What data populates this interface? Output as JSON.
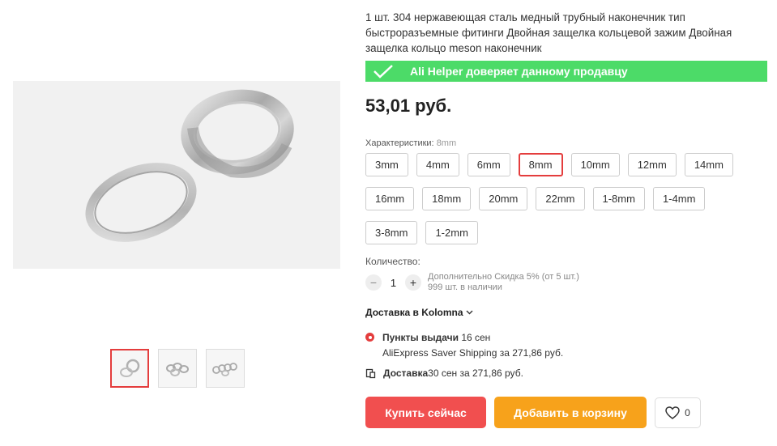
{
  "product": {
    "title": "1 шт. 304 нержавеющая сталь медный трубный наконечник тип быстроразъемные фитинги Двойная защелка кольцевой зажим Двойная защелка кольцо meson наконечник",
    "trust_badge": "Ali Helper доверяет данному продавцу",
    "price": "53,01 руб."
  },
  "gallery": {
    "thumbnails": [
      "thumb-1",
      "thumb-2",
      "thumb-3"
    ]
  },
  "specs": {
    "label": "Характеристики: ",
    "selected": "8mm",
    "options": [
      "3mm",
      "4mm",
      "6mm",
      "8mm",
      "10mm",
      "12mm",
      "14mm",
      "16mm",
      "18mm",
      "20mm",
      "22mm",
      "1-8mm",
      "1-4mm",
      "3-8mm",
      "1-2mm"
    ]
  },
  "quantity": {
    "label": "Количество:",
    "value": "1",
    "minus": "−",
    "plus": "+",
    "discount": "Дополнительно Скидка 5% (от 5 шт.)",
    "stock": "999 шт. в наличии"
  },
  "delivery": {
    "heading": "Доставка в Kolomna",
    "pickup_title": "Пункты выдачи",
    "pickup_date": " 16 сен",
    "pickup_service": "AliExpress Saver Shipping за 271,86 руб.",
    "courier_title": "Доставка",
    "courier_info": " 30 сен за 271,86 руб."
  },
  "actions": {
    "buy": "Купить сейчас",
    "cart": "Добавить в корзину",
    "wishlist_count": "0"
  },
  "colors": {
    "accent_red": "#e43d3d",
    "buy_button": "#f14f4f",
    "cart_button": "#f7a21b",
    "trust_green": "#4cdb68"
  }
}
